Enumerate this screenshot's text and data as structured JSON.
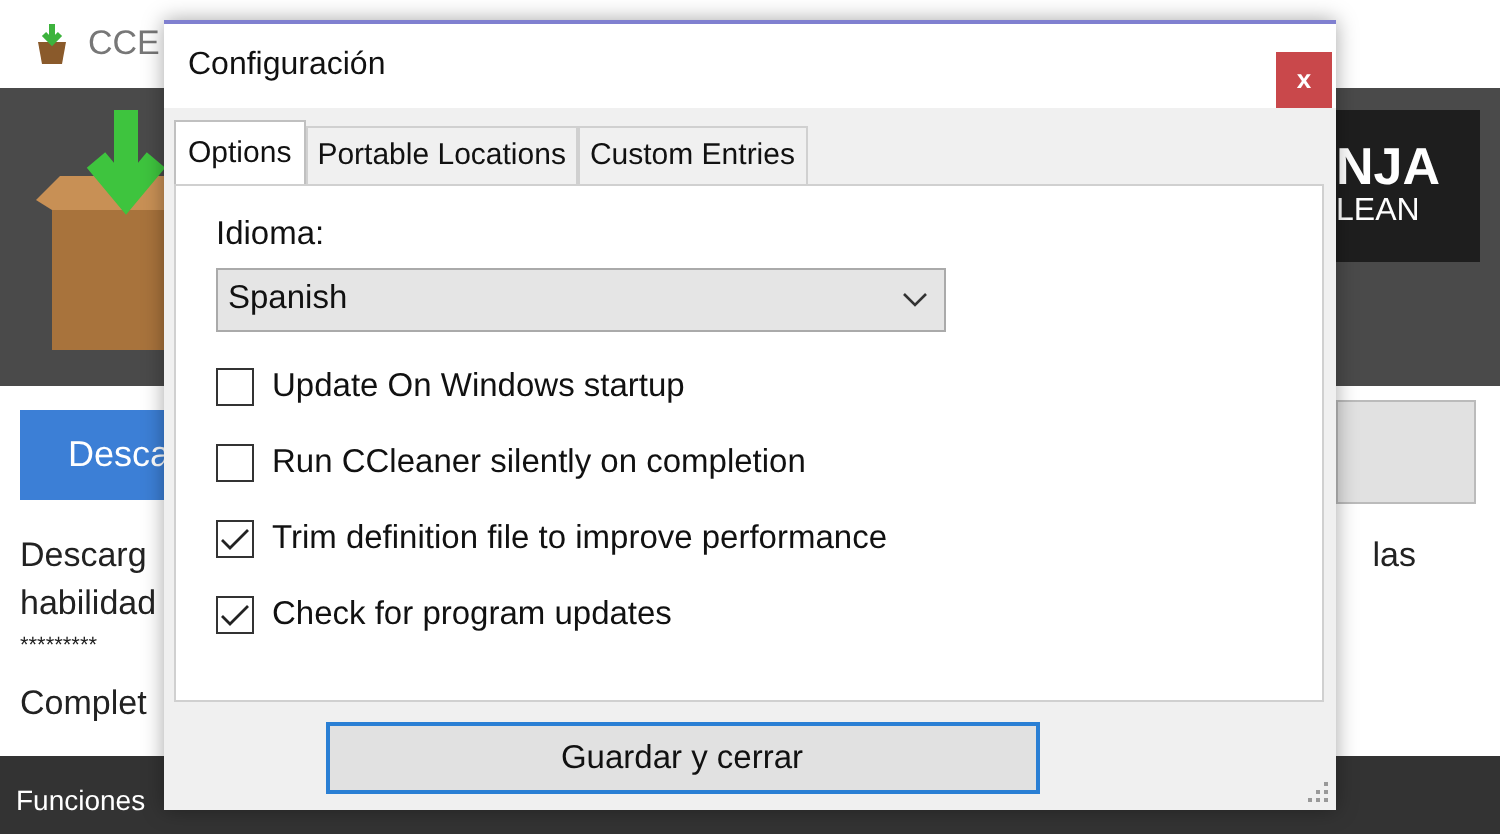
{
  "main_window": {
    "title": "CCE",
    "banner": {
      "line_1": "NJA",
      "line_2": "LEAN"
    },
    "download_button": "Desca",
    "body_lines": [
      "Descarg",
      "habilidad",
      "*********",
      "Complet"
    ],
    "body_tail": "las",
    "bottom_tabs": [
      "Funciones"
    ]
  },
  "dialog": {
    "title": "Configuración",
    "close": "x",
    "tabs": [
      {
        "label": "Options",
        "selected": true
      },
      {
        "label": "Portable Locations",
        "selected": false
      },
      {
        "label": "Custom Entries",
        "selected": false
      }
    ],
    "language_label": "Idioma:",
    "language": "Spanish",
    "options": [
      {
        "label": "Update On Windows startup",
        "checked": false
      },
      {
        "label": "Run CCleaner silently on completion",
        "checked": false
      },
      {
        "label": "Trim definition file to improve performance",
        "checked": true
      },
      {
        "label": "Check for program updates",
        "checked": true
      }
    ],
    "save_button": "Guardar y cerrar"
  }
}
